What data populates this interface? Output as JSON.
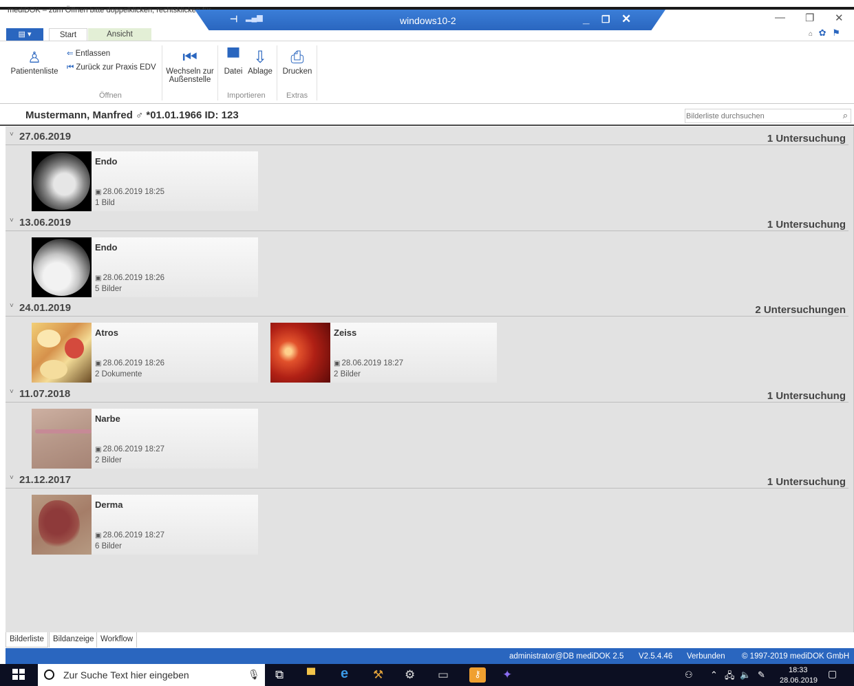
{
  "window": {
    "title": "mediDOK – zum Öffnen bitte doppelklicken, rechtsklicken für",
    "rdp_title": "windows10-2",
    "rdp_watermark": "mediDOK"
  },
  "ribbon": {
    "app_menu_label": "▤ ▾",
    "tabs": [
      {
        "label": "Start",
        "active": true
      },
      {
        "label": "Ansicht",
        "active": false
      }
    ],
    "groups": {
      "oeffnen": {
        "label": "Öffnen",
        "patientenliste": "Patientenliste",
        "entlassen": "Entlassen",
        "zurueck": "Zurück zur Praxis EDV"
      },
      "wechseln": {
        "label_line1": "Wechseln zur",
        "label_line2": "Außenstelle"
      },
      "importieren": {
        "label": "Importieren",
        "datei": "Datei",
        "ablage": "Ablage"
      },
      "extras": {
        "label": "Extras",
        "drucken": "Drucken"
      }
    }
  },
  "patient": {
    "info": "Mustermann, Manfred  ♂  *01.01.1966  ID: 123"
  },
  "search": {
    "placeholder": "Bilderliste durchsuchen"
  },
  "groups": [
    {
      "date": "27.06.2019",
      "count": "1 Untersuchung",
      "cards": [
        {
          "title": "Endo",
          "date": "28.06.2019 18:25",
          "count": "1 Bild",
          "thumb": "endoscopy-image"
        }
      ]
    },
    {
      "date": "13.06.2019",
      "count": "1 Untersuchung",
      "cards": [
        {
          "title": "Endo",
          "date": "28.06.2019 18:26",
          "count": "5 Bilder",
          "thumb": "endoscopy-image"
        }
      ]
    },
    {
      "date": "24.01.2019",
      "count": "2 Untersuchungen",
      "cards": [
        {
          "title": "Atros",
          "date": "28.06.2019 18:26",
          "count": "2 Dokumente",
          "thumb": "joint-image"
        },
        {
          "title": "Zeiss",
          "date": "28.06.2019 18:27",
          "count": "2 Bilder",
          "thumb": "retina-image"
        }
      ]
    },
    {
      "date": "11.07.2018",
      "count": "1 Untersuchung",
      "cards": [
        {
          "title": "Narbe",
          "date": "28.06.2019 18:27",
          "count": "2 Bilder",
          "thumb": "scar-image"
        }
      ]
    },
    {
      "date": "21.12.2017",
      "count": "1 Untersuchung",
      "cards": [
        {
          "title": "Derma",
          "date": "28.06.2019 18:27",
          "count": "6 Bilder",
          "thumb": "skin-image"
        }
      ]
    }
  ],
  "bottom_tabs": [
    {
      "label": "Bilderliste",
      "active": true
    },
    {
      "label": "Bildanzeige",
      "active": false
    },
    {
      "label": "Workflow",
      "active": false
    }
  ],
  "status": {
    "user": "administrator@DB mediDOK 2.5",
    "version": "V2.5.4.46",
    "connection": "Verbunden",
    "copyright": "© 1997-2019 mediDOK GmbH"
  },
  "taskbar": {
    "search_placeholder": "Zur Suche Text hier eingeben",
    "time": "18:33",
    "date": "28.06.2019"
  },
  "colors": {
    "accent": "#2a66bf",
    "content_bg": "#e2e2e2",
    "taskbar_bg": "#0c0f22"
  }
}
